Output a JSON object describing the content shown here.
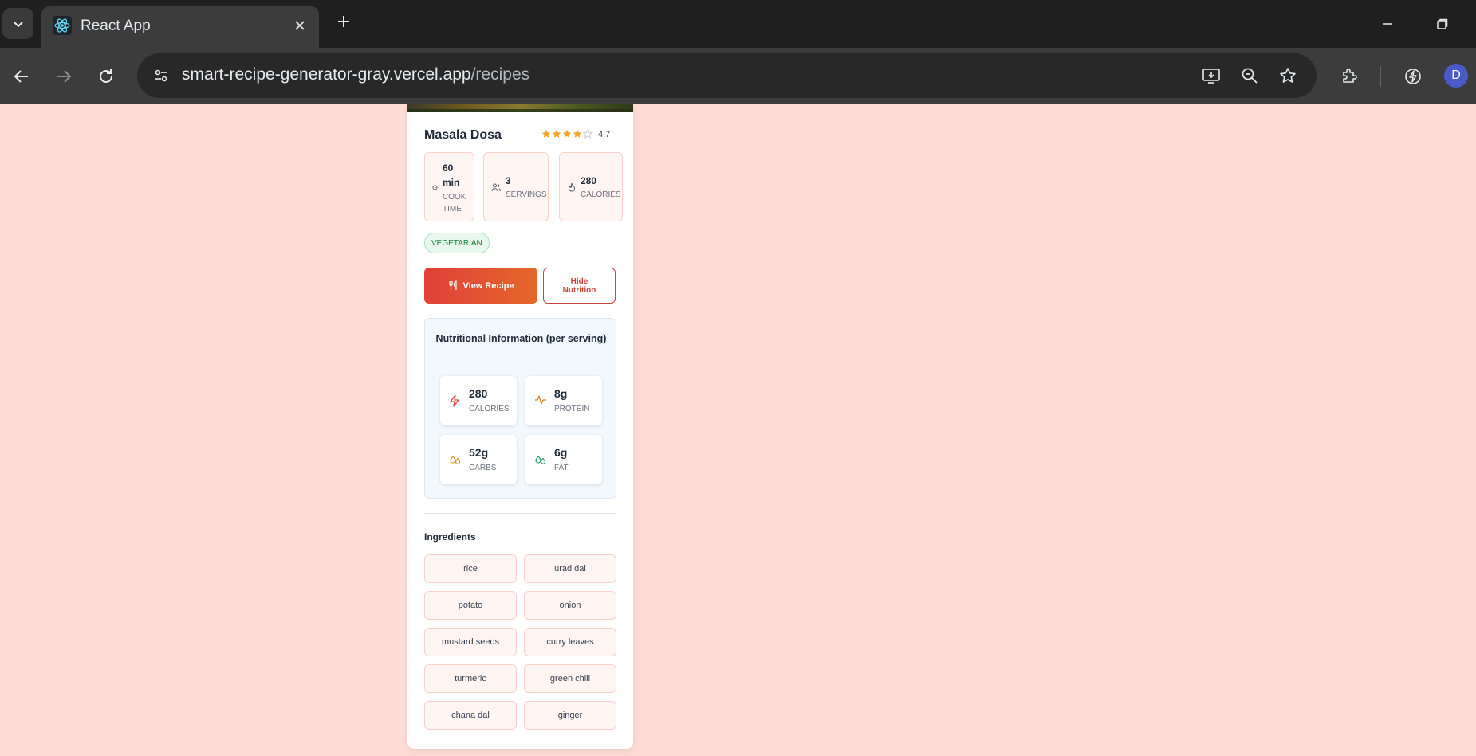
{
  "browser": {
    "tab_title": "React App",
    "url_host": "smart-recipe-generator-gray.vercel.app",
    "url_path": "/recipes",
    "profile_initial": "D"
  },
  "recipe": {
    "title": "Masala Dosa",
    "rating": "4.7",
    "stars_filled": 4,
    "stars_total": 5,
    "stats": {
      "cook_time_value_line1": "60",
      "cook_time_value_line2": "min",
      "cook_time_label_line1": "COOK",
      "cook_time_label_line2": "TIME",
      "servings_value": "3",
      "servings_label": "SERVINGS",
      "calories_value": "280",
      "calories_label": "CALORIES"
    },
    "badge": "VEGETARIAN",
    "view_button": "View Recipe",
    "hide_button": "Hide Nutrition",
    "nutrition": {
      "title": "Nutritional Information (per serving)",
      "calories_value": "280",
      "calories_label": "CALORIES",
      "protein_value": "8g",
      "protein_label": "PROTEIN",
      "carbs_value": "52g",
      "carbs_label": "CARBS",
      "fat_value": "6g",
      "fat_label": "FAT"
    },
    "ingredients_title": "Ingredients",
    "ingredients": [
      "rice",
      "urad dal",
      "potato",
      "onion",
      "mustard seeds",
      "curry leaves",
      "turmeric",
      "green chili",
      "chana dal",
      "ginger"
    ]
  },
  "colors": {
    "page_bg": "#fedbd5",
    "accent_red": "#e2403a",
    "accent_orange": "#e4672a",
    "star": "#f5a524",
    "veg_green": "#15803d"
  }
}
